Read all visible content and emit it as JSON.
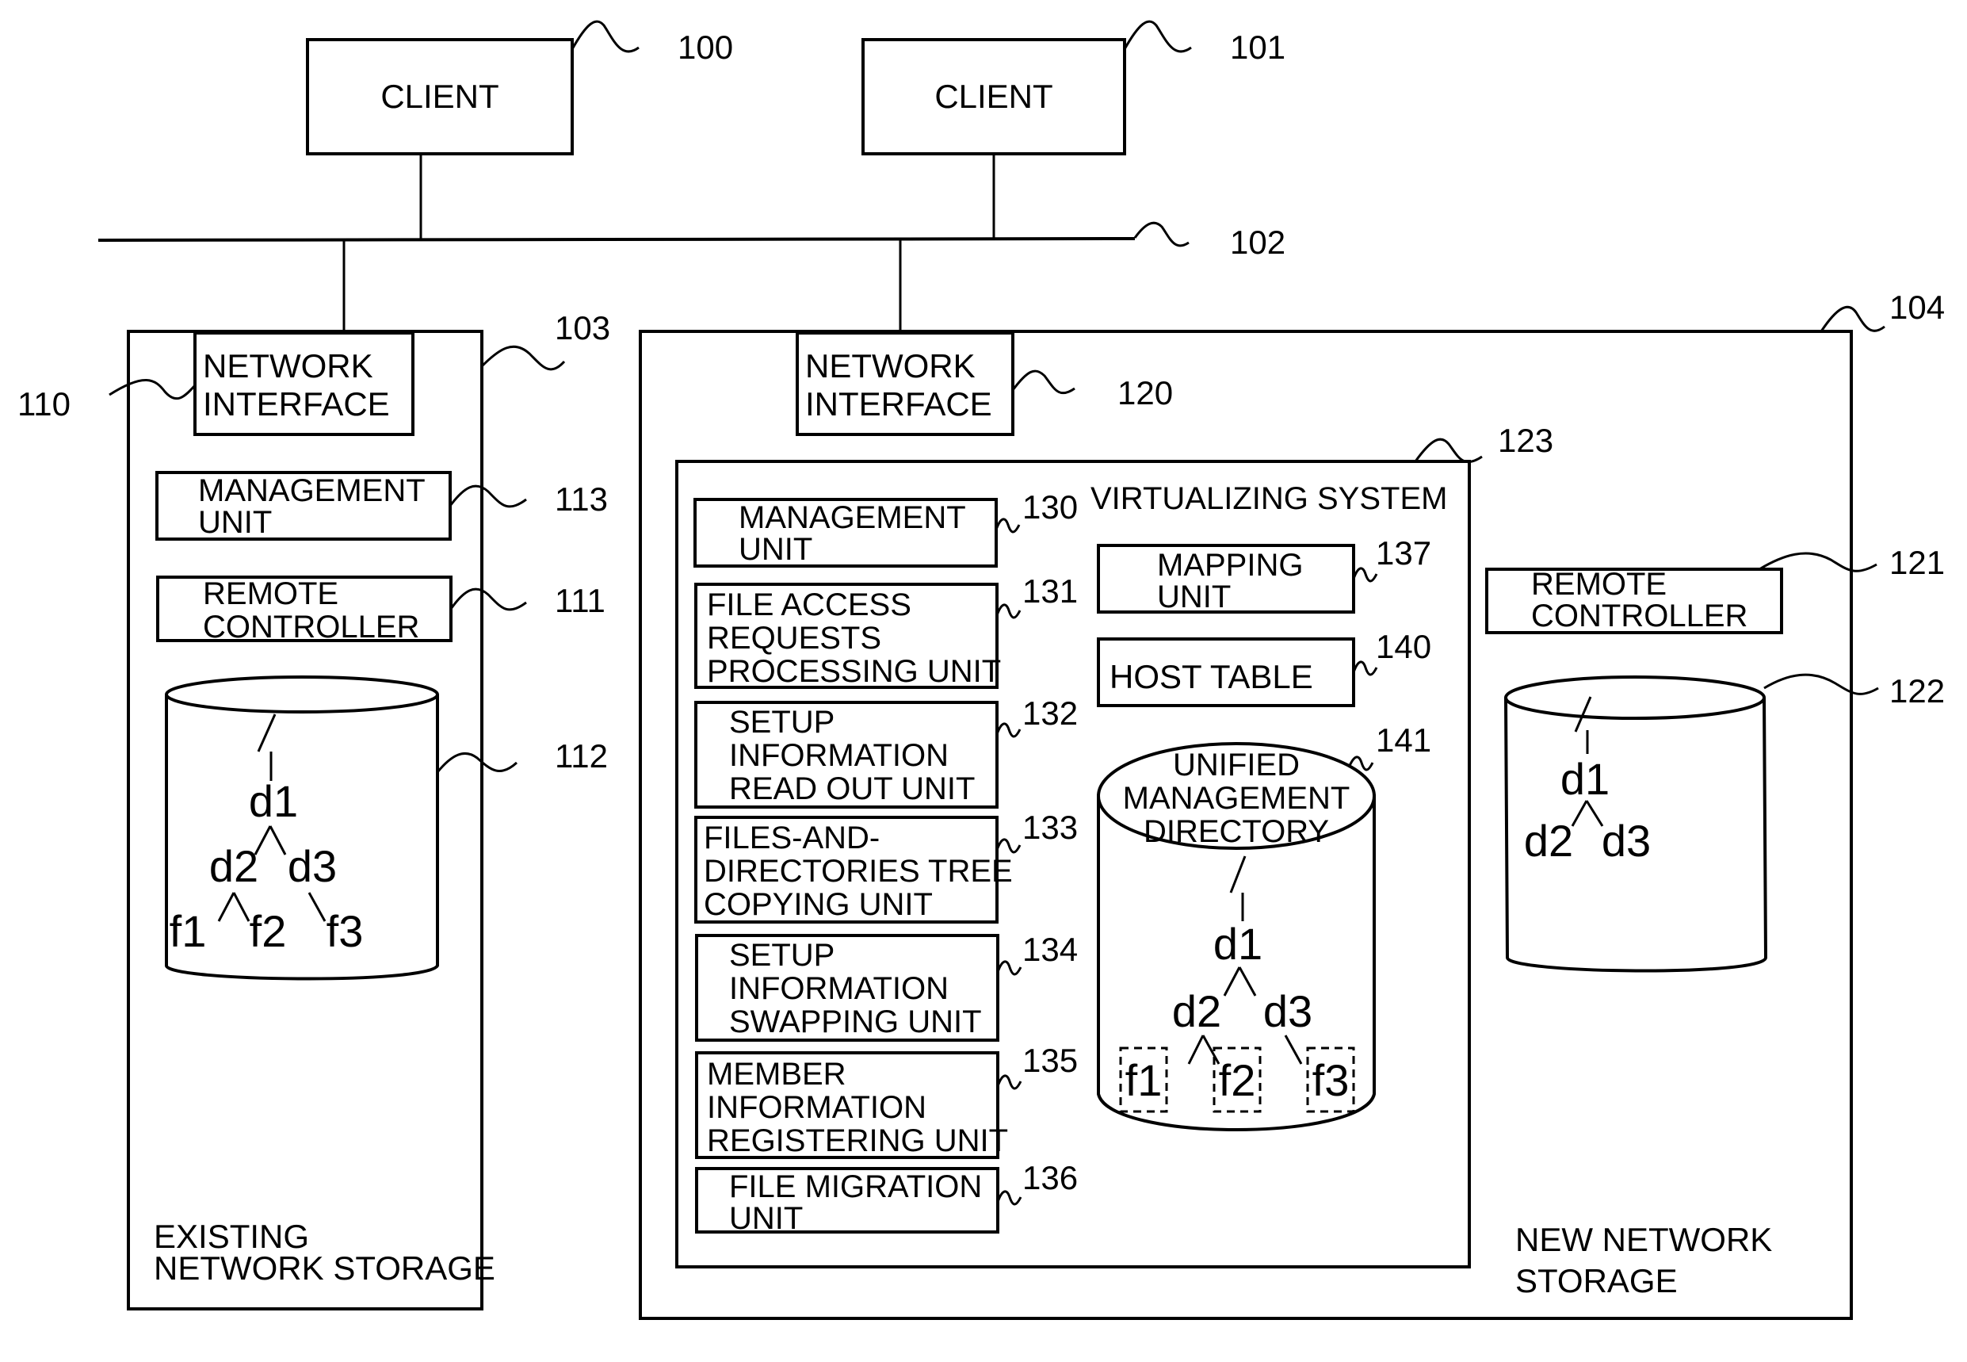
{
  "diagram": {
    "clients": [
      {
        "ref": "100",
        "label": "CLIENT"
      },
      {
        "ref": "101",
        "label": "CLIENT"
      }
    ],
    "network": {
      "ref": "102"
    },
    "existing_storage": {
      "ref": "103",
      "title": [
        "EXISTING",
        "NETWORK STORAGE"
      ],
      "network_interface": {
        "ref": "110",
        "label": [
          "NETWORK",
          "INTERFACE"
        ]
      },
      "management_unit": {
        "ref": "113",
        "label": [
          "MANAGEMENT",
          "UNIT"
        ]
      },
      "remote_controller": {
        "ref": "111",
        "label": [
          "REMOTE",
          "CONTROLLER"
        ]
      },
      "disk": {
        "ref": "112",
        "tree": {
          "root": "/",
          "d1": "d1",
          "d2": "d2",
          "d3": "d3",
          "f1": "f1",
          "f2": "f2",
          "f3": "f3"
        }
      }
    },
    "new_storage": {
      "ref": "104",
      "title": [
        "NEW NETWORK",
        "STORAGE"
      ],
      "network_interface": {
        "ref": "120",
        "label": [
          "NETWORK",
          "INTERFACE"
        ]
      },
      "remote_controller": {
        "ref": "121",
        "label": [
          "REMOTE",
          "CONTROLLER"
        ]
      },
      "disk": {
        "ref": "122",
        "tree": {
          "root": "/",
          "d1": "d1",
          "d2": "d2",
          "d3": "d3"
        }
      },
      "virtualizing_system": {
        "ref": "123",
        "title": "VIRTUALIZING SYSTEM",
        "units": [
          {
            "ref": "130",
            "label": [
              "MANAGEMENT",
              "UNIT"
            ]
          },
          {
            "ref": "131",
            "label": [
              "FILE ACCESS",
              "REQUESTS",
              "PROCESSING UNIT"
            ]
          },
          {
            "ref": "132",
            "label": [
              "SETUP",
              "INFORMATION",
              "READ OUT UNIT"
            ]
          },
          {
            "ref": "133",
            "label": [
              "FILES-AND-",
              "DIRECTORIES TREE",
              "COPYING UNIT"
            ]
          },
          {
            "ref": "134",
            "label": [
              "SETUP",
              "INFORMATION",
              "SWAPPING UNIT"
            ]
          },
          {
            "ref": "135",
            "label": [
              "MEMBER",
              "INFORMATION",
              "REGISTERING UNIT"
            ]
          },
          {
            "ref": "136",
            "label": [
              "FILE MIGRATION",
              "UNIT"
            ]
          }
        ],
        "mapping_unit": {
          "ref": "137",
          "label": [
            "MAPPING",
            "UNIT"
          ]
        },
        "host_table": {
          "ref": "140",
          "label": "HOST TABLE"
        },
        "unified_directory": {
          "ref": "141",
          "label": [
            "UNIFIED",
            "MANAGEMENT",
            "DIRECTORY"
          ],
          "tree": {
            "root": "/",
            "d1": "d1",
            "d2": "d2",
            "d3": "d3",
            "f1": "f1",
            "f2": "f2",
            "f3": "f3"
          }
        }
      }
    }
  }
}
